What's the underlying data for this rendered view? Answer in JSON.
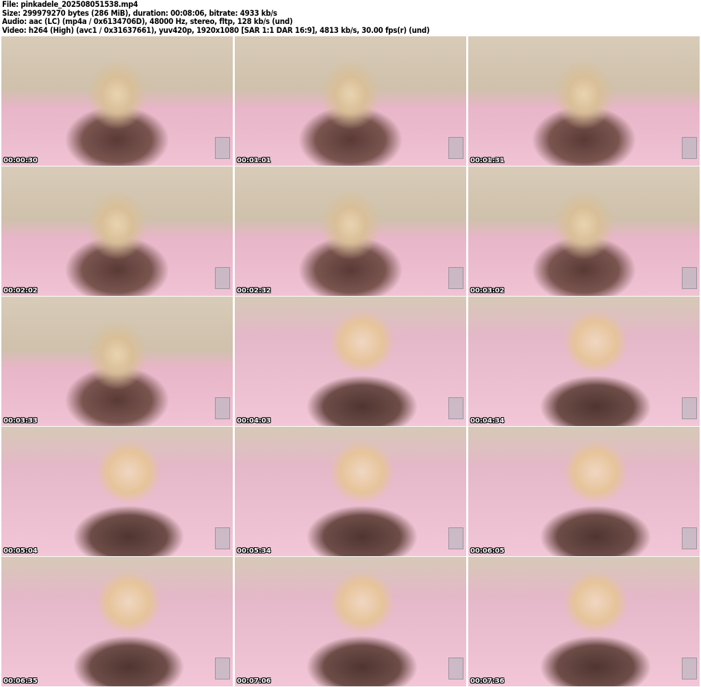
{
  "header": {
    "file": "File: pinkadele_202508051538.mp4",
    "size": "Size: 299979270 bytes (286 MiB), duration: 00:08:06, bitrate: 4933 kb/s",
    "audio": "Audio: aac (LC) (mp4a / 0x6134706D), 48000 Hz, stereo, fltp, 128 kb/s (und)",
    "video": "Video: h264 (High) (avc1 / 0x31637661), yuv420p, 1920x1080 [SAR 1:1 DAR 16:9], 4813 kb/s, 30.00 fps(r) (und)"
  },
  "thumbnails": [
    {
      "time": "00:00:30"
    },
    {
      "time": "00:01:01"
    },
    {
      "time": "00:01:31"
    },
    {
      "time": "00:02:02"
    },
    {
      "time": "00:02:32"
    },
    {
      "time": "00:03:02"
    },
    {
      "time": "00:03:33"
    },
    {
      "time": "00:04:03"
    },
    {
      "time": "00:04:34"
    },
    {
      "time": "00:05:04"
    },
    {
      "time": "00:05:34"
    },
    {
      "time": "00:06:05"
    },
    {
      "time": "00:06:35"
    },
    {
      "time": "00:07:06"
    },
    {
      "time": "00:07:36"
    }
  ]
}
